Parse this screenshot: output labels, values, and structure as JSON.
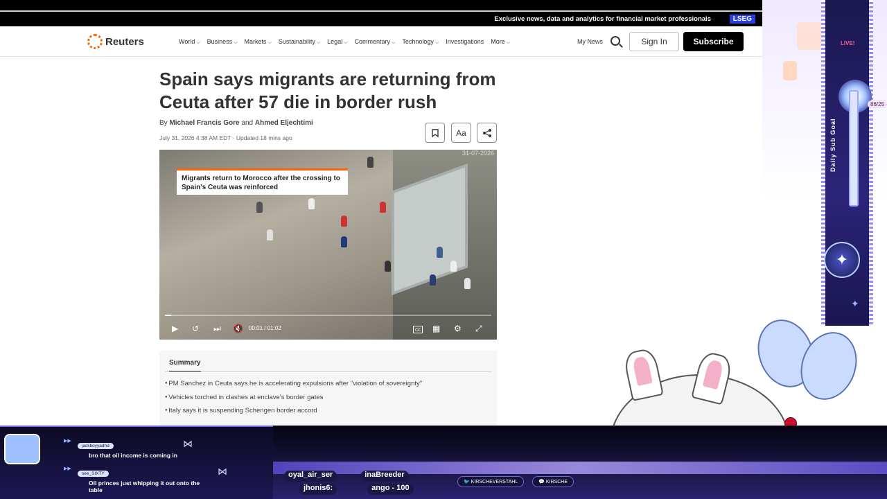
{
  "topbar": {
    "tagline": "Exclusive news, data and analytics for financial market professionals",
    "lseg": "LSEG"
  },
  "nav": {
    "logo": "Reuters",
    "links": [
      "World",
      "Business",
      "Markets",
      "Sustainability",
      "Legal",
      "Commentary",
      "Technology",
      "Investigations",
      "More"
    ],
    "my_news": "My News",
    "sign_in": "Sign In",
    "subscribe": "Subscribe"
  },
  "article": {
    "headline": "Spain says migrants are returning from Ceuta after 57 die in border rush",
    "by": "By",
    "author1": "Michael Francis Gore",
    "and": "and",
    "author2": "Ahmed Eljechtimi",
    "dateline": "July 31, 2026 4:38 AM EDT · Updated 18 mins ago",
    "tools": {
      "bookmark_icon": "bookmark-icon",
      "text_size": "Aa",
      "share_icon": "share-icon"
    }
  },
  "video": {
    "caption": "Migrants return to Morocco after the crossing to Spain's Ceuta was reinforced",
    "corner_date": "31-07-2026",
    "time_current": "00:01",
    "time_sep": "/",
    "time_total": "01:02",
    "progress": 0.02
  },
  "summary": {
    "tab": "Summary",
    "items": [
      "PM Sanchez in Ceuta says he is accelerating expulsions after \"violation of sovereignty\"",
      "Vehicles torched in clashes at enclave's border gates",
      "Italy says it is suspending Schengen border accord"
    ]
  },
  "stream": {
    "live": "LIVE!",
    "goal_label": "Daily Sub Goal",
    "goal_count": "86/25",
    "ticker_top": [
      "oyal_air_ser",
      "inaBreeder"
    ],
    "ticker_bottom": [
      "jhonis6:",
      "ango - 100"
    ],
    "socials": [
      "KIRSCHEVERSTAHL",
      "KIRSCHE"
    ],
    "chat": [
      {
        "user": "jackboyyadhd",
        "text": "bro that oil income is coming in"
      },
      {
        "user": "see_SIXTY",
        "text": "Oil princes just whipping it out onto the table"
      }
    ]
  }
}
